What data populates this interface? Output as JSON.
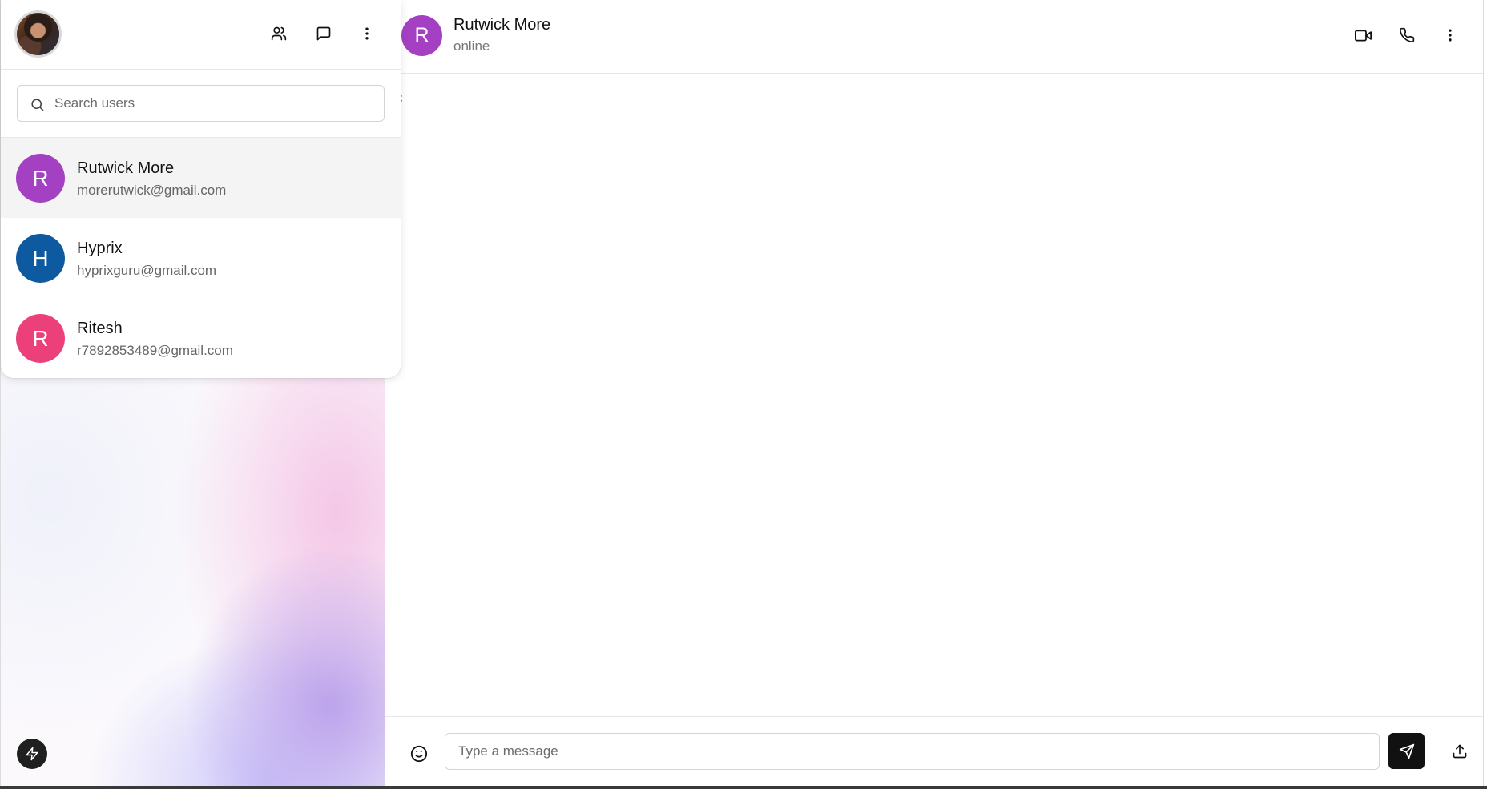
{
  "sidebar": {
    "header_icons": [
      "users-icon",
      "message-square-icon",
      "more-vertical-icon"
    ],
    "search": {
      "placeholder": "Search users",
      "value": ""
    },
    "users": [
      {
        "initial": "R",
        "name": "Rutwick More",
        "email": "morerutwick@gmail.com",
        "color": "#a441c2",
        "active": true
      },
      {
        "initial": "H",
        "name": "Hyprix",
        "email": "hyprixguru@gmail.com",
        "color": "#0d5aa0",
        "active": false
      },
      {
        "initial": "R",
        "name": "Ritesh",
        "email": "r7892853489@gmail.com",
        "color": "#ec407a",
        "active": false
      }
    ]
  },
  "chat": {
    "contact": {
      "initial": "R",
      "name": "Rutwick More",
      "status": "online",
      "color": "#a441c2"
    },
    "header_icons": [
      "video-icon",
      "phone-icon",
      "more-vertical-icon"
    ],
    "stray_text": ";",
    "composer": {
      "placeholder": "Type a message",
      "value": ""
    }
  },
  "colors": {
    "accent_dark": "#111111",
    "border": "#e6e6e6"
  }
}
